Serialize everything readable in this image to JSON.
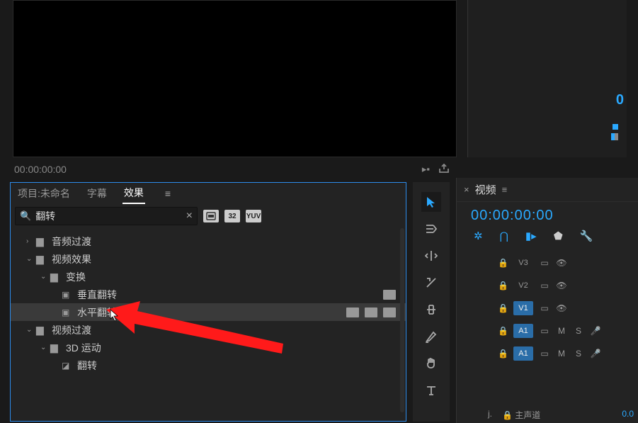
{
  "viewer": {
    "timecode_left": "00:00:00:00",
    "timecode_right_partial": "0"
  },
  "effects_panel": {
    "tabs": {
      "project": "项目:未命名",
      "captions": "字幕",
      "effects": "效果"
    },
    "search_value": "翻转",
    "badges": [
      "",
      "32",
      "YUV"
    ],
    "tree": {
      "audio_transitions": "音频过渡",
      "video_effects": "视频效果",
      "transform": "变换",
      "vertical_flip": "垂直翻转",
      "horizontal_flip": "水平翻转",
      "video_transitions": "视频过渡",
      "three_d_motion": "3D 运动",
      "flip": "翻转"
    }
  },
  "timeline": {
    "close": "×",
    "title": "视频",
    "timecode": "00:00:00:00",
    "tracks": {
      "v3": "V3",
      "v2": "V2",
      "v1": "V1",
      "a1": "A1",
      "a1b": "A1"
    },
    "ms": {
      "m": "M",
      "s": "S"
    },
    "footer": {
      "label": "主声道",
      "value": "0.0",
      "prefix": "j."
    }
  }
}
